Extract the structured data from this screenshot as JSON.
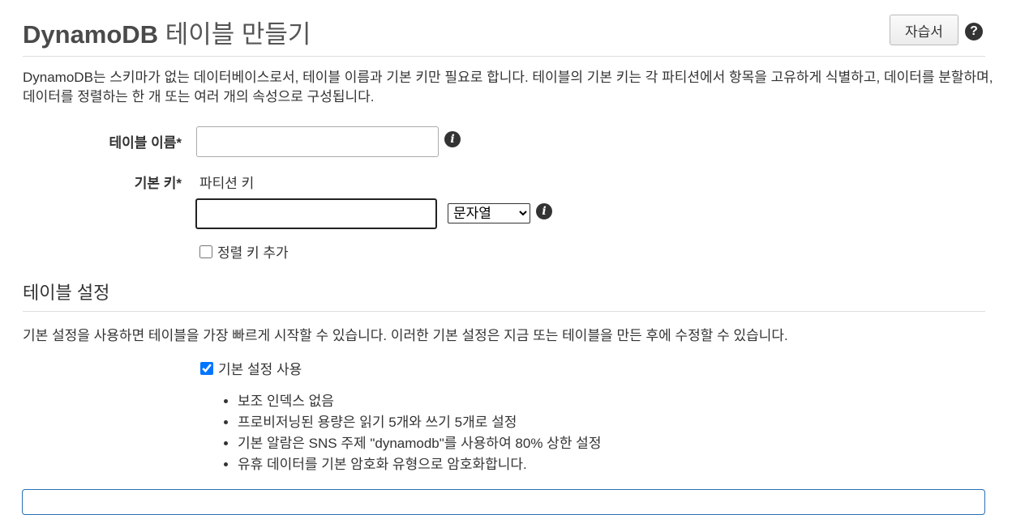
{
  "header": {
    "title_strong": "DynamoDB",
    "title_rest": " 테이블 만들기",
    "tutorial_label": "자습서",
    "help_glyph": "?"
  },
  "description": "DynamoDB는 스키마가 없는 데이터베이스로서, 테이블 이름과 기본 키만 필요로 합니다. 테이블의 기본 키는 각 파티션에서 항목을 고유하게 식별하고, 데이터를 분할하며, 데이터를 정렬하는 한 개 또는 여러 개의 속성으로 구성됩니다.",
  "form": {
    "table_name_label": "테이블 이름*",
    "table_name_value": "",
    "primary_key_label": "기본 키*",
    "partition_key_label": "파티션 키",
    "partition_key_value": "",
    "key_type_options": [
      "문자열"
    ],
    "key_type_selected": "문자열",
    "add_sort_key_label": "정렬 키 추가",
    "add_sort_key_checked": false,
    "info_glyph": "i"
  },
  "settings": {
    "title": "테이블 설정",
    "description": "기본 설정을 사용하면 테이블을 가장 빠르게 시작할 수 있습니다. 이러한 기본 설정은 지금 또는 테이블을 만든 후에 수정할 수 있습니다.",
    "use_default_label": "기본 설정 사용",
    "use_default_checked": true,
    "defaults": [
      "보조 인덱스 없음",
      "프로비저닝된 용량은 읽기 5개와 쓰기 5개로 설정",
      "기본 알람은 SNS 주제 \"dynamodb\"를 사용하여 80% 상한 설정",
      "유휴 데이터를 기본 암호화 유형으로 암호화합니다."
    ]
  },
  "colors": {
    "panel_border": "#2a6fb3",
    "icon_dark": "#333333"
  }
}
